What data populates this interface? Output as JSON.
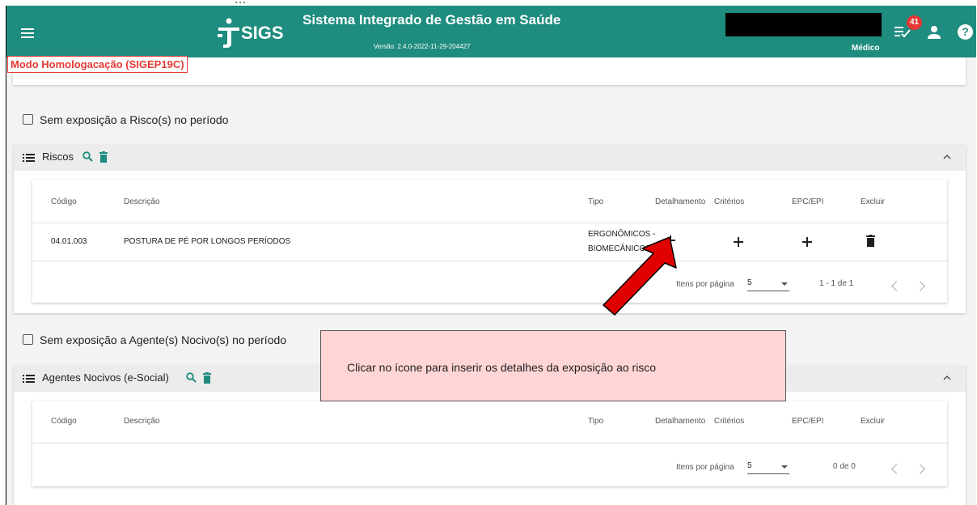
{
  "app": {
    "logo_text": "SIGS",
    "title": "Sistema Integrado de Gestão em Saúde",
    "version": "Versão: 2.4.0-2022-11-29-204427",
    "role": "Médico",
    "notification_count": "41",
    "help_label": "?",
    "modo": "Modo Homologacação (SIGEP19C)"
  },
  "riscos_section": {
    "checkbox_label": "Sem exposição a Risco(s) no período",
    "title": "Riscos",
    "headers": [
      "Código",
      "Descrição",
      "Tipo",
      "Detalhamento",
      "Critérios",
      "EPC/EPI",
      "Excluir"
    ],
    "row": {
      "codigo": "04.01.003",
      "descricao": "POSTURA DE PÉ POR LONGOS PERÍODOS",
      "tipo_line1": "ERGONÔMICOS -",
      "tipo_line2": "BIOMECÂNICOS"
    },
    "paginator": {
      "label": "Itens por página",
      "size": "5",
      "range": "1 - 1 de 1"
    }
  },
  "agentes_section": {
    "checkbox_label": "Sem exposição a Agente(s) Nocivo(s) no período",
    "title": "Agentes Nocivos (e-Social)",
    "headers": [
      "Código",
      "Descrição",
      "Tipo",
      "Detalhamento",
      "Critérios",
      "EPC/EPI",
      "Excluir"
    ],
    "paginator": {
      "label": "Itens por página",
      "size": "5",
      "range": "0 de 0"
    }
  },
  "callout": {
    "text": "Clicar no ícone para inserir os detalhes da exposição ao risco"
  },
  "colors": {
    "appbar": "#1e8c7e",
    "accent": "#1e8c7e",
    "badge": "#e53935",
    "callout_bg": "#ffd5d5",
    "arrow": "#e00000"
  }
}
